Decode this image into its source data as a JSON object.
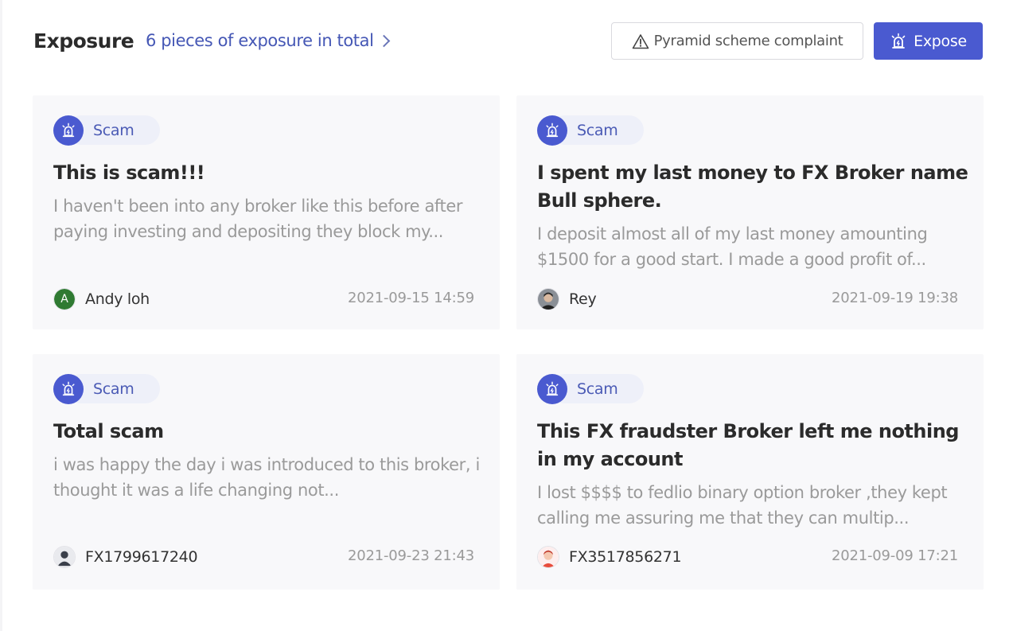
{
  "header": {
    "title": "Exposure",
    "total_link": "6 pieces of exposure in total",
    "complaint_button": "Pyramid scheme complaint",
    "expose_button": "Expose"
  },
  "colors": {
    "accent": "#4a5ad0",
    "link": "#4557b5",
    "card_bg": "#f8f8fa",
    "muted_text": "#9a9a9a"
  },
  "cards": [
    {
      "tag": "Scam",
      "title": "This is scam!!!",
      "description": "I haven't been into any broker like this before after paying investing and depositing they block my...",
      "author": "Andy loh",
      "avatar_letter": "A",
      "date": "2021-09-15 14:59"
    },
    {
      "tag": "Scam",
      "title": "I spent my last money to FX Broker name Bull sphere.",
      "description": "I deposit almost all of my last money amounting $1500 for a good start. I made a good profit of...",
      "author": "Rey",
      "date": "2021-09-19 19:38"
    },
    {
      "tag": "Scam",
      "title": "Total scam",
      "description": "i was happy the day i was introduced to this broker, i thought it was a life changing not...",
      "author": "FX1799617240",
      "date": "2021-09-23 21:43"
    },
    {
      "tag": "Scam",
      "title": "This FX fraudster Broker left me nothing in my account",
      "description": "I lost $$$$ to fedlio binary option broker ,they kept calling me assuring me that they can multip...",
      "author": "FX3517856271",
      "date": "2021-09-09 17:21"
    }
  ]
}
